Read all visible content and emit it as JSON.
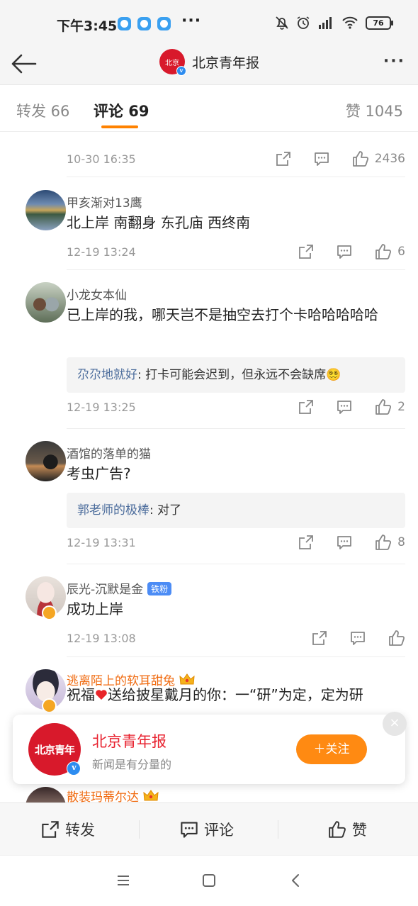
{
  "status_bar": {
    "time": "下午3:45",
    "more": "···",
    "battery": "76"
  },
  "nav": {
    "title": "北京青年报",
    "more": "···"
  },
  "tabs": {
    "repost": "转发 66",
    "comment": "评论 69",
    "like": "赞 1045"
  },
  "post_meta": {
    "time": "10-30 16:35",
    "likes": "2436"
  },
  "comments": [
    {
      "name": "甲亥渐对13鹰",
      "text": "北上岸  南翻身  东孔庙  西终南",
      "time": "12-19 13:24",
      "likes": "6"
    },
    {
      "name": "小龙女本仙",
      "text": "已上岸的我，哪天岂不是抽空去打个卡哈哈哈哈哈",
      "reply_name": "尕尕地就好",
      "reply_text": ": 打卡可能会迟到，但永远不会缺席😵‍💫",
      "time": "12-19 13:25",
      "likes": "2"
    },
    {
      "name": "酒馆的落单的猫",
      "text": "考虫广告?",
      "reply_name": "郭老师的极棒",
      "reply_text": ": 对了",
      "time": "12-19 13:31",
      "likes": "8"
    },
    {
      "name": "辰光-沉默是金",
      "badge": "铁粉",
      "text": "成功上岸",
      "time": "12-19 13:08",
      "likes": ""
    },
    {
      "name": "逃离陌上的软耳甜兔",
      "text_prefix": "祝福",
      "text_suffix": "送给披星戴月的你：一“研”为定，定为研"
    },
    {
      "name": "散装玛蒂尔达"
    }
  ],
  "follow_card": {
    "name": "北京青年报",
    "subtitle": "新闻是有分量的",
    "button": "＋关注",
    "close": "×"
  },
  "bottom_bar": {
    "repost": "转发",
    "comment": "评论",
    "like": "赞"
  },
  "colors": {
    "accent": "#ff8200",
    "brand_red": "#d8192b",
    "link_blue": "#4a6b9b"
  }
}
